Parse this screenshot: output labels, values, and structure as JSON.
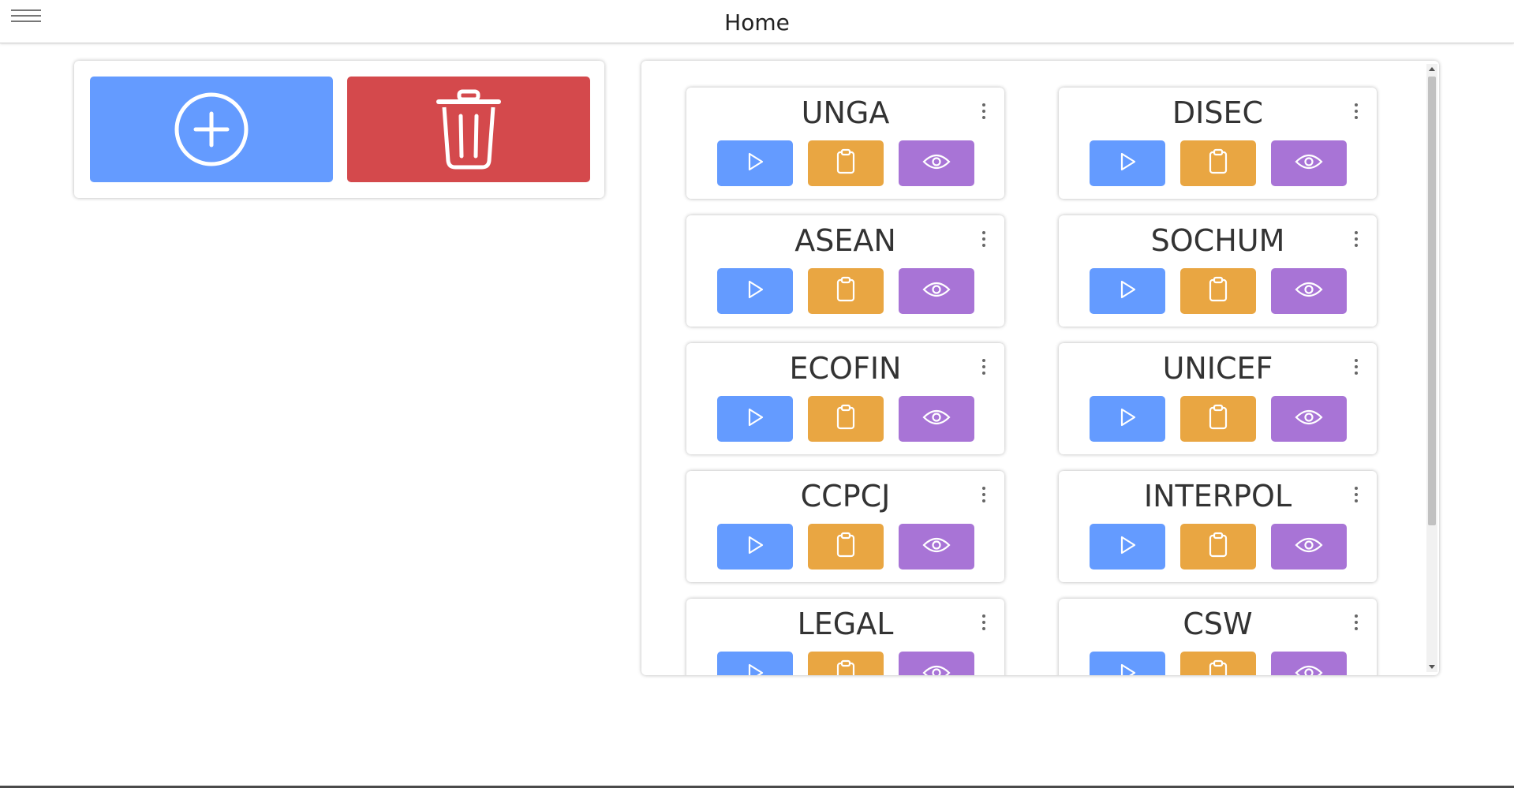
{
  "header": {
    "title": "Home",
    "menu_icon": "hamburger-menu-icon"
  },
  "actions": {
    "add": {
      "icon": "add-circle-icon",
      "color": "#649bff"
    },
    "delete": {
      "icon": "trash-icon",
      "color": "#d4494c"
    }
  },
  "colors": {
    "start": "#649bff",
    "notes": "#e9a642",
    "view": "#a874d6"
  },
  "card_icons": {
    "start": "play-icon",
    "notes": "clipboard-icon",
    "view": "eye-icon",
    "menu": "kebab-menu-icon"
  },
  "committees": [
    {
      "name": "UNGA"
    },
    {
      "name": "DISEC"
    },
    {
      "name": "ASEAN"
    },
    {
      "name": "SOCHUM"
    },
    {
      "name": "ECOFIN"
    },
    {
      "name": "UNICEF"
    },
    {
      "name": "CCPCJ"
    },
    {
      "name": "INTERPOL"
    },
    {
      "name": "LEGAL"
    },
    {
      "name": "CSW"
    }
  ]
}
